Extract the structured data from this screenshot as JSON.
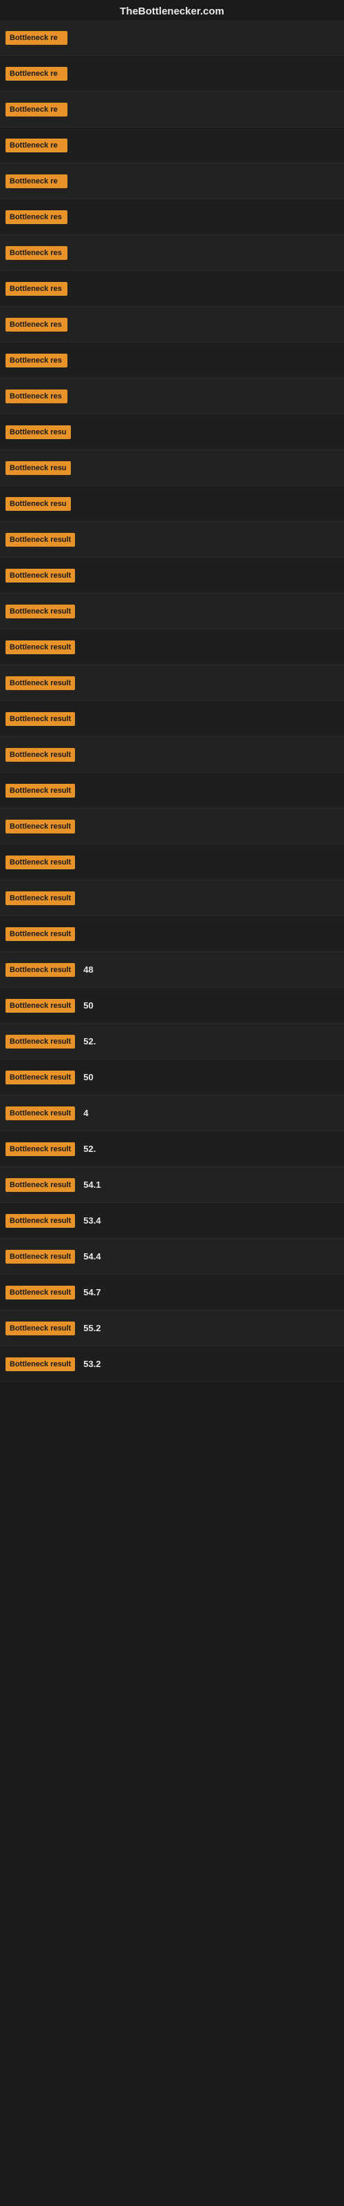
{
  "header": {
    "site": "TheBottlenecker.com"
  },
  "rows": [
    {
      "label": "Bottleneck re",
      "value": ""
    },
    {
      "label": "Bottleneck re",
      "value": ""
    },
    {
      "label": "Bottleneck re",
      "value": ""
    },
    {
      "label": "Bottleneck re",
      "value": ""
    },
    {
      "label": "Bottleneck re",
      "value": ""
    },
    {
      "label": "Bottleneck res",
      "value": ""
    },
    {
      "label": "Bottleneck res",
      "value": ""
    },
    {
      "label": "Bottleneck res",
      "value": ""
    },
    {
      "label": "Bottleneck res",
      "value": ""
    },
    {
      "label": "Bottleneck res",
      "value": ""
    },
    {
      "label": "Bottleneck res",
      "value": ""
    },
    {
      "label": "Bottleneck resu",
      "value": ""
    },
    {
      "label": "Bottleneck resu",
      "value": ""
    },
    {
      "label": "Bottleneck resu",
      "value": ""
    },
    {
      "label": "Bottleneck result",
      "value": ""
    },
    {
      "label": "Bottleneck result",
      "value": ""
    },
    {
      "label": "Bottleneck result",
      "value": ""
    },
    {
      "label": "Bottleneck result",
      "value": ""
    },
    {
      "label": "Bottleneck result",
      "value": ""
    },
    {
      "label": "Bottleneck result",
      "value": ""
    },
    {
      "label": "Bottleneck result",
      "value": ""
    },
    {
      "label": "Bottleneck result",
      "value": ""
    },
    {
      "label": "Bottleneck result",
      "value": ""
    },
    {
      "label": "Bottleneck result",
      "value": ""
    },
    {
      "label": "Bottleneck result",
      "value": ""
    },
    {
      "label": "Bottleneck result",
      "value": ""
    },
    {
      "label": "Bottleneck result",
      "value": "48"
    },
    {
      "label": "Bottleneck result",
      "value": "50"
    },
    {
      "label": "Bottleneck result",
      "value": "52."
    },
    {
      "label": "Bottleneck result",
      "value": "50"
    },
    {
      "label": "Bottleneck result",
      "value": "4"
    },
    {
      "label": "Bottleneck result",
      "value": "52."
    },
    {
      "label": "Bottleneck result",
      "value": "54.1"
    },
    {
      "label": "Bottleneck result",
      "value": "53.4"
    },
    {
      "label": "Bottleneck result",
      "value": "54.4"
    },
    {
      "label": "Bottleneck result",
      "value": "54.7"
    },
    {
      "label": "Bottleneck result",
      "value": "55.2"
    },
    {
      "label": "Bottleneck result",
      "value": "53.2"
    }
  ]
}
